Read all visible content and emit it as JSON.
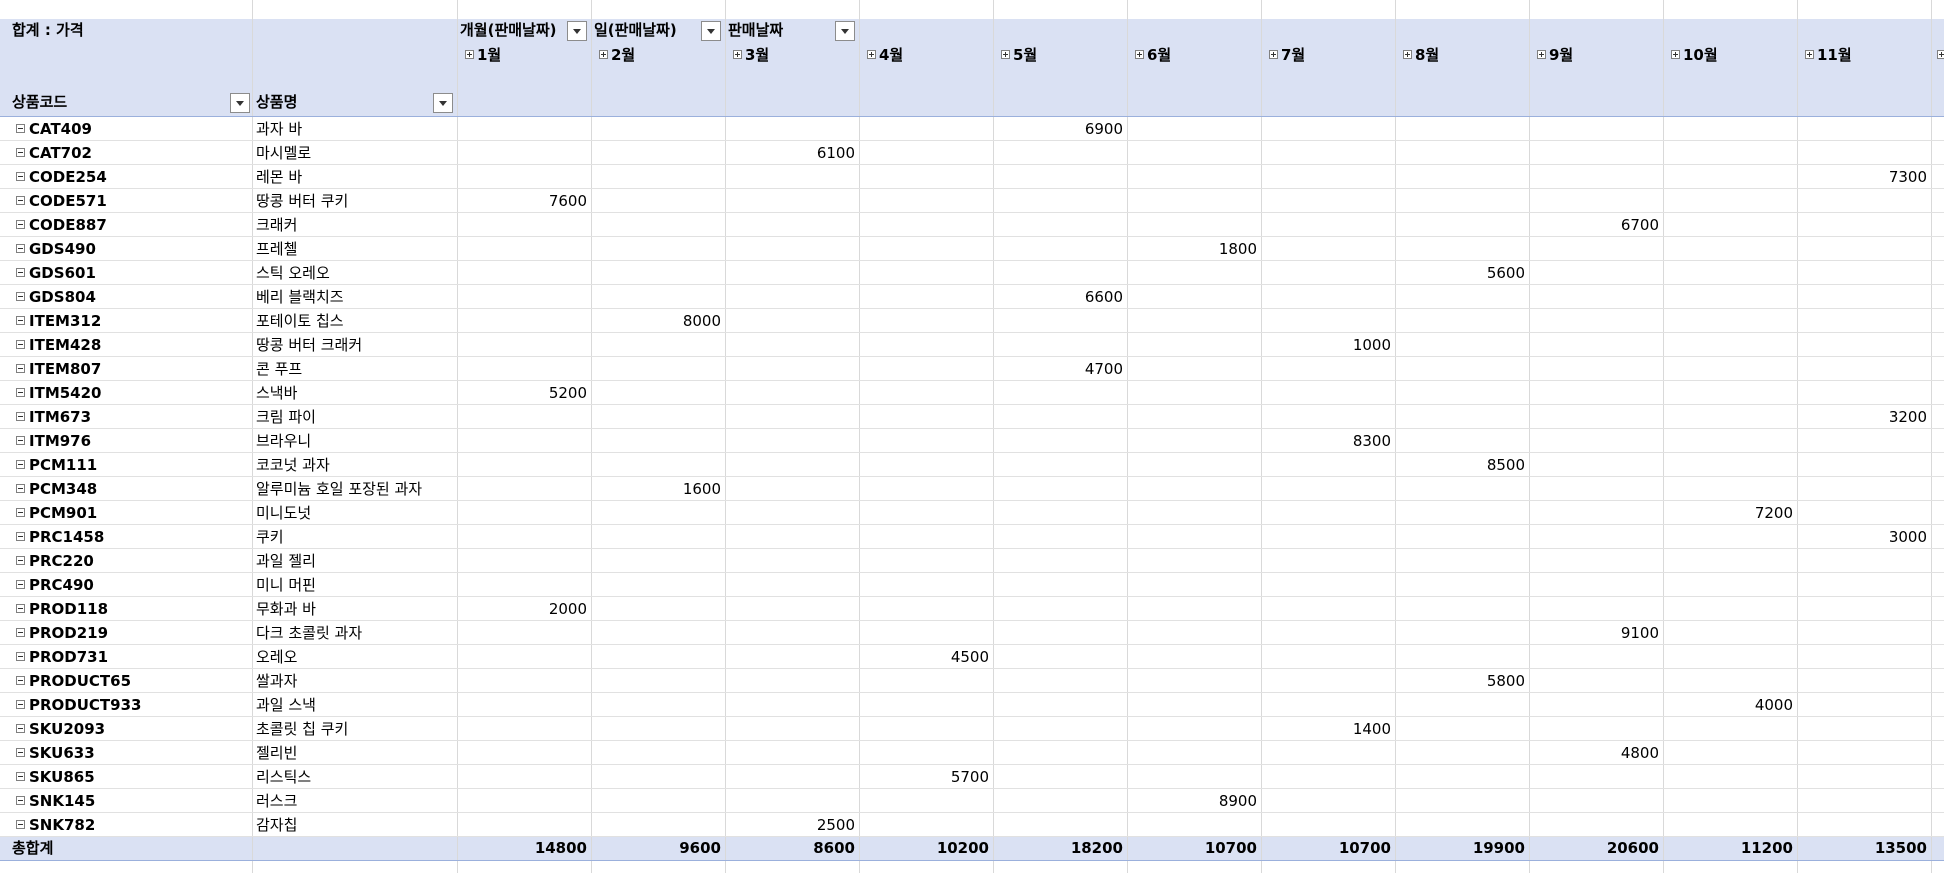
{
  "pivot": {
    "values_label": "합계 : 가격",
    "column_fields": [
      "개월(판매날짜)",
      "일(판매날짜)",
      "판매날짜"
    ],
    "row_field_labels": [
      "상품코드",
      "상품명"
    ],
    "months": [
      "1월",
      "2월",
      "3월",
      "4월",
      "5월",
      "6월",
      "7월",
      "8월",
      "9월",
      "10월",
      "11월"
    ],
    "rows": [
      {
        "code": "CAT409",
        "name": "과자 바",
        "values": [
          "",
          "",
          "",
          "",
          "6900",
          "",
          "",
          "",
          "",
          "",
          ""
        ]
      },
      {
        "code": "CAT702",
        "name": "마시멜로",
        "values": [
          "",
          "",
          "6100",
          "",
          "",
          "",
          "",
          "",
          "",
          "",
          ""
        ]
      },
      {
        "code": "CODE254",
        "name": "레몬 바",
        "values": [
          "",
          "",
          "",
          "",
          "",
          "",
          "",
          "",
          "",
          "",
          "7300"
        ]
      },
      {
        "code": "CODE571",
        "name": "땅콩 버터 쿠키",
        "values": [
          "7600",
          "",
          "",
          "",
          "",
          "",
          "",
          "",
          "",
          "",
          ""
        ]
      },
      {
        "code": "CODE887",
        "name": "크래커",
        "values": [
          "",
          "",
          "",
          "",
          "",
          "",
          "",
          "",
          "6700",
          "",
          ""
        ]
      },
      {
        "code": "GDS490",
        "name": "프레첼",
        "values": [
          "",
          "",
          "",
          "",
          "",
          "1800",
          "",
          "",
          "",
          "",
          ""
        ]
      },
      {
        "code": "GDS601",
        "name": "스틱 오레오",
        "values": [
          "",
          "",
          "",
          "",
          "",
          "",
          "",
          "5600",
          "",
          "",
          ""
        ]
      },
      {
        "code": "GDS804",
        "name": "베리 블랙치즈",
        "values": [
          "",
          "",
          "",
          "",
          "6600",
          "",
          "",
          "",
          "",
          "",
          ""
        ]
      },
      {
        "code": "ITEM312",
        "name": "포테이토 칩스",
        "values": [
          "",
          "8000",
          "",
          "",
          "",
          "",
          "",
          "",
          "",
          "",
          ""
        ]
      },
      {
        "code": "ITEM428",
        "name": "땅콩 버터 크래커",
        "values": [
          "",
          "",
          "",
          "",
          "",
          "",
          "1000",
          "",
          "",
          "",
          ""
        ]
      },
      {
        "code": "ITEM807",
        "name": "콘 푸프",
        "values": [
          "",
          "",
          "",
          "",
          "4700",
          "",
          "",
          "",
          "",
          "",
          ""
        ]
      },
      {
        "code": "ITM5420",
        "name": "스낵바",
        "values": [
          "5200",
          "",
          "",
          "",
          "",
          "",
          "",
          "",
          "",
          "",
          ""
        ]
      },
      {
        "code": "ITM673",
        "name": "크림 파이",
        "values": [
          "",
          "",
          "",
          "",
          "",
          "",
          "",
          "",
          "",
          "",
          "3200"
        ]
      },
      {
        "code": "ITM976",
        "name": "브라우니",
        "values": [
          "",
          "",
          "",
          "",
          "",
          "",
          "8300",
          "",
          "",
          "",
          ""
        ]
      },
      {
        "code": "PCM111",
        "name": "코코넛 과자",
        "values": [
          "",
          "",
          "",
          "",
          "",
          "",
          "",
          "8500",
          "",
          "",
          ""
        ]
      },
      {
        "code": "PCM348",
        "name": "알루미늄 호일 포장된 과자",
        "values": [
          "",
          "1600",
          "",
          "",
          "",
          "",
          "",
          "",
          "",
          "",
          ""
        ]
      },
      {
        "code": "PCM901",
        "name": "미니도넛",
        "values": [
          "",
          "",
          "",
          "",
          "",
          "",
          "",
          "",
          "",
          "7200",
          ""
        ]
      },
      {
        "code": "PRC1458",
        "name": "쿠키",
        "values": [
          "",
          "",
          "",
          "",
          "",
          "",
          "",
          "",
          "",
          "",
          "3000"
        ]
      },
      {
        "code": "PRC220",
        "name": "과일 젤리",
        "values": [
          "",
          "",
          "",
          "",
          "",
          "",
          "",
          "",
          "",
          "",
          ""
        ]
      },
      {
        "code": "PRC490",
        "name": "미니 머핀",
        "values": [
          "",
          "",
          "",
          "",
          "",
          "",
          "",
          "",
          "",
          "",
          ""
        ]
      },
      {
        "code": "PROD118",
        "name": "무화과 바",
        "values": [
          "2000",
          "",
          "",
          "",
          "",
          "",
          "",
          "",
          "",
          "",
          ""
        ]
      },
      {
        "code": "PROD219",
        "name": "다크 초콜릿 과자",
        "values": [
          "",
          "",
          "",
          "",
          "",
          "",
          "",
          "",
          "9100",
          "",
          ""
        ]
      },
      {
        "code": "PROD731",
        "name": "오레오",
        "values": [
          "",
          "",
          "",
          "4500",
          "",
          "",
          "",
          "",
          "",
          "",
          ""
        ]
      },
      {
        "code": "PRODUCT65",
        "name": "쌀과자",
        "values": [
          "",
          "",
          "",
          "",
          "",
          "",
          "",
          "5800",
          "",
          "",
          ""
        ]
      },
      {
        "code": "PRODUCT933",
        "name": "과일 스낵",
        "values": [
          "",
          "",
          "",
          "",
          "",
          "",
          "",
          "",
          "",
          "4000",
          ""
        ]
      },
      {
        "code": "SKU2093",
        "name": "초콜릿 칩 쿠키",
        "values": [
          "",
          "",
          "",
          "",
          "",
          "",
          "1400",
          "",
          "",
          "",
          ""
        ]
      },
      {
        "code": "SKU633",
        "name": "젤리빈",
        "values": [
          "",
          "",
          "",
          "",
          "",
          "",
          "",
          "",
          "4800",
          "",
          ""
        ]
      },
      {
        "code": "SKU865",
        "name": "리스틱스",
        "values": [
          "",
          "",
          "",
          "5700",
          "",
          "",
          "",
          "",
          "",
          "",
          ""
        ]
      },
      {
        "code": "SNK145",
        "name": "러스크",
        "values": [
          "",
          "",
          "",
          "",
          "",
          "8900",
          "",
          "",
          "",
          "",
          ""
        ]
      },
      {
        "code": "SNK782",
        "name": "감자칩",
        "values": [
          "",
          "",
          "2500",
          "",
          "",
          "",
          "",
          "",
          "",
          "",
          ""
        ]
      }
    ],
    "grand_total_label": "총합계",
    "grand_totals": [
      "14800",
      "9600",
      "8600",
      "10200",
      "18200",
      "10700",
      "10700",
      "19900",
      "20600",
      "11200",
      "13500"
    ]
  },
  "colors": {
    "header_band": "#dae1f3",
    "gridline": "#d9d9d9"
  },
  "icons": {
    "dropdown": "chevron-down-icon",
    "collapse": "collapse-minus-icon",
    "expand": "expand-plus-icon"
  }
}
